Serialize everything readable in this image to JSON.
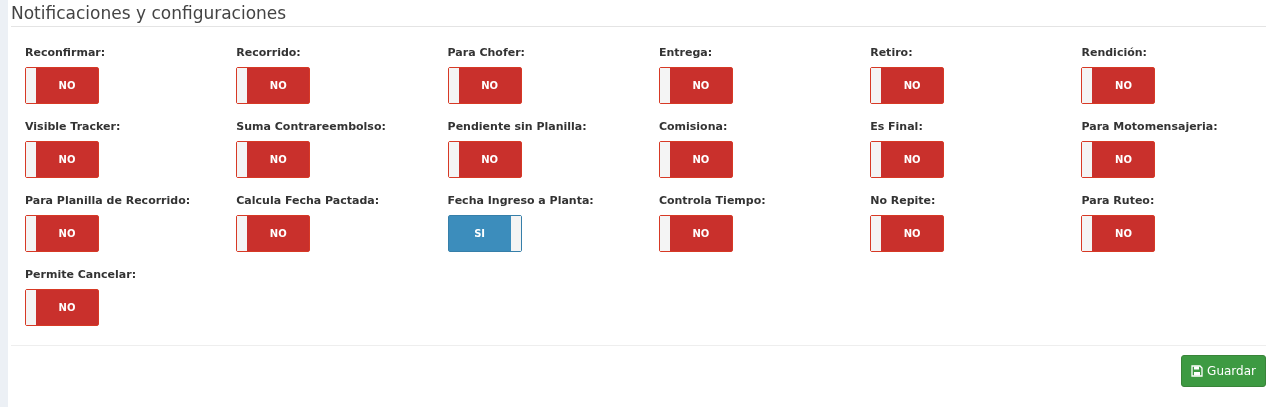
{
  "title": "Notificaciones y configuraciones",
  "settings": [
    {
      "label": "Reconfirmar:",
      "on": false,
      "state_text": "NO"
    },
    {
      "label": "Recorrido:",
      "on": false,
      "state_text": "NO"
    },
    {
      "label": "Para Chofer:",
      "on": false,
      "state_text": "NO"
    },
    {
      "label": "Entrega:",
      "on": false,
      "state_text": "NO"
    },
    {
      "label": "Retiro:",
      "on": false,
      "state_text": "NO"
    },
    {
      "label": "Rendición:",
      "on": false,
      "state_text": "NO"
    },
    {
      "label": "Visible Tracker:",
      "on": false,
      "state_text": "NO"
    },
    {
      "label": "Suma Contrareembolso:",
      "on": false,
      "state_text": "NO"
    },
    {
      "label": "Pendiente sin Planilla:",
      "on": false,
      "state_text": "NO"
    },
    {
      "label": "Comisiona:",
      "on": false,
      "state_text": "NO"
    },
    {
      "label": "Es Final:",
      "on": false,
      "state_text": "NO"
    },
    {
      "label": "Para Motomensajeria:",
      "on": false,
      "state_text": "NO"
    },
    {
      "label": "Para Planilla de Recorrido:",
      "on": false,
      "state_text": "NO"
    },
    {
      "label": "Calcula Fecha Pactada:",
      "on": false,
      "state_text": "NO"
    },
    {
      "label": "Fecha Ingreso a Planta:",
      "on": true,
      "state_text": "SI"
    },
    {
      "label": "Controla Tiempo:",
      "on": false,
      "state_text": "NO"
    },
    {
      "label": "No Repite:",
      "on": false,
      "state_text": "NO"
    },
    {
      "label": "Para Ruteo:",
      "on": false,
      "state_text": "NO"
    },
    {
      "label": "Permite Cancelar:",
      "on": false,
      "state_text": "NO"
    }
  ],
  "save_button": "Guardar"
}
